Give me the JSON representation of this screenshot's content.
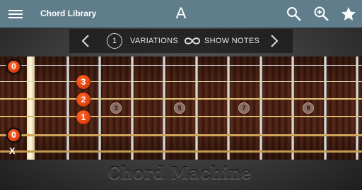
{
  "app_title": "Chord Library",
  "chord": "A",
  "variation_number": "1",
  "variations_label": "VARIATIONS",
  "show_notes_label": "SHOW NOTES",
  "fret_markers": [
    "3",
    "5",
    "7",
    "9"
  ],
  "strings": [
    {
      "state": "open",
      "label": "0"
    },
    {
      "state": "fretted",
      "fret": "3",
      "label": "3"
    },
    {
      "state": "fretted",
      "fret": "2",
      "label": "2"
    },
    {
      "state": "fretted",
      "fret": "1",
      "label": "1"
    },
    {
      "state": "open",
      "label": "0"
    },
    {
      "state": "muted",
      "label": "X"
    }
  ],
  "brand": "Chord Machine",
  "colors": {
    "topbar": "#607d8b",
    "note": "#e8450f",
    "nut": "#f5ecc8"
  }
}
